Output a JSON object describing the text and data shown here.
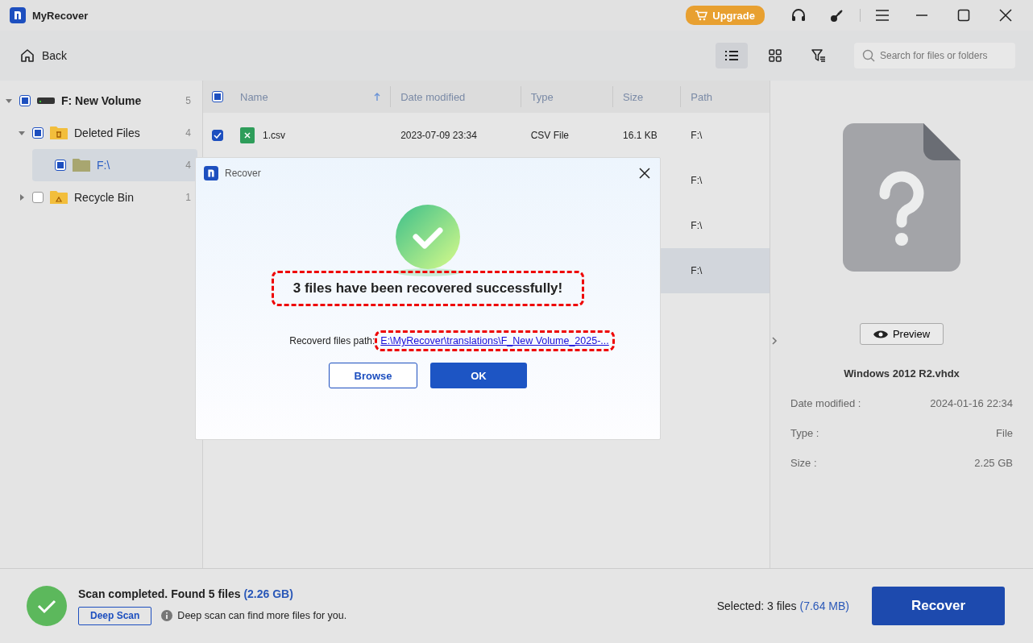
{
  "window": {
    "title": "MyRecover",
    "upgrade": "Upgrade"
  },
  "toolbar": {
    "back": "Back",
    "views": [
      {
        "kind": "list",
        "selected": true
      },
      {
        "kind": "grid",
        "selected": false
      },
      {
        "kind": "filter",
        "selected": false
      }
    ],
    "search": {
      "placeholder": "Search for files or folders"
    }
  },
  "tree": [
    {
      "label": "F: New Volume",
      "kind": "drive",
      "count": "5",
      "checked": false,
      "partial": true,
      "expanded": true,
      "selected": false,
      "children": [
        {
          "label": "Deleted Files",
          "kind": "trash",
          "count": "4",
          "checked": false,
          "partial": true,
          "expanded": true,
          "selected": false,
          "children": [
            {
              "label": "F:\\",
              "kind": "folder",
              "count": "4",
              "checked": false,
              "partial": true,
              "selected": true
            }
          ]
        },
        {
          "label": "Recycle Bin",
          "kind": "recycle",
          "count": "1",
          "checked": false,
          "partial": false,
          "expanded": false,
          "selected": false
        }
      ]
    }
  ],
  "table": {
    "header_checked": false,
    "header_partial": true,
    "columns": [
      {
        "label": "Name",
        "sorted_ascending": true
      },
      {
        "label": "Date modified"
      },
      {
        "label": "Type"
      },
      {
        "label": "Size"
      },
      {
        "label": "Path"
      }
    ],
    "rows": [
      {
        "checked": true,
        "selected": false,
        "name": "1.csv",
        "date": "2023-07-09 23:34",
        "type": "CSV File",
        "size": "16.1 KB",
        "path": "F:\\"
      },
      {
        "selected": false,
        "path": "F:\\"
      },
      {
        "selected": false,
        "path": "F:\\"
      },
      {
        "selected": true,
        "path": "F:\\"
      }
    ]
  },
  "details": {
    "preview": "Preview",
    "file_name": "Windows 2012 R2.vhdx",
    "fields": [
      {
        "label": "Date modified :",
        "value": "2024-01-16 22:34"
      },
      {
        "label": "Type :",
        "value": "File"
      },
      {
        "label": "Size :",
        "value": "2.25 GB"
      }
    ]
  },
  "dialog": {
    "title": "Recover",
    "message": "3 files have been recovered successfully!",
    "message_highlighted": true,
    "path_label": "Recoverd files path:",
    "path": "E:\\MyRecover\\translations\\F_New Volume_2025-...",
    "path_highlighted": true,
    "buttons": [
      {
        "label": "Browse",
        "kind": "secondary"
      },
      {
        "label": "OK",
        "kind": "primary"
      }
    ]
  },
  "status_bar": {
    "status": "Scan completed. Found 5 files",
    "status_size": "(2.26 GB)",
    "deep_scan": "Deep Scan",
    "hint": "Deep scan can find more files for you.",
    "selected": "Selected: 3 files",
    "selected_size": "(7.64 MB)",
    "recover": "Recover"
  }
}
